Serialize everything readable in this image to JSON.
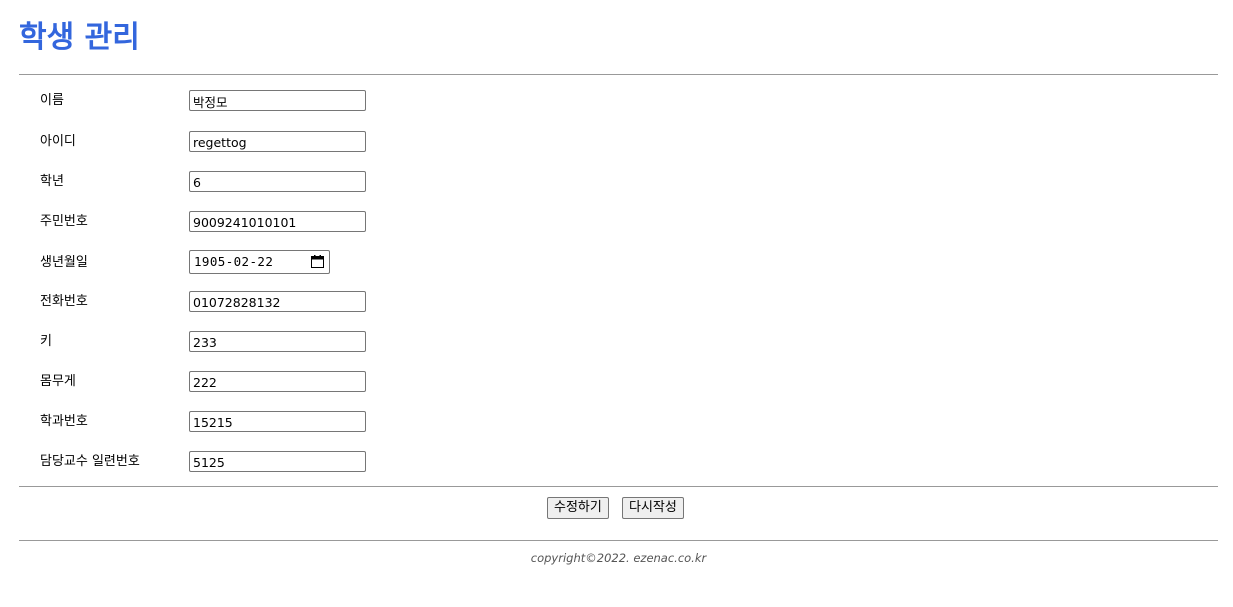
{
  "header": {
    "title": "학생 관리"
  },
  "form": {
    "name": {
      "label": "이름",
      "value": "박정모"
    },
    "id": {
      "label": "아이디",
      "value": "regettog"
    },
    "grade": {
      "label": "학년",
      "value": "6"
    },
    "resident_number": {
      "label": "주민번호",
      "value": "9009241010101"
    },
    "birth_date": {
      "label": "생년월일",
      "value": "1905-02-22"
    },
    "phone": {
      "label": "전화번호",
      "value": "01072828132"
    },
    "height": {
      "label": "키",
      "value": "233"
    },
    "weight": {
      "label": "몸무게",
      "value": "222"
    },
    "department_number": {
      "label": "학과번호",
      "value": "15215"
    },
    "advisor_number": {
      "label": "담당교수 일련번호",
      "value": "5125"
    }
  },
  "actions": {
    "submit_label": "수정하기",
    "reset_label": "다시작성"
  },
  "footer": {
    "copyright": "copyright©2022. ezenac.co.kr"
  },
  "colors": {
    "title": "#3366dd",
    "rule": "#999999",
    "footer_text": "#555555"
  },
  "icons": {
    "date_picker": "calendar-icon"
  }
}
